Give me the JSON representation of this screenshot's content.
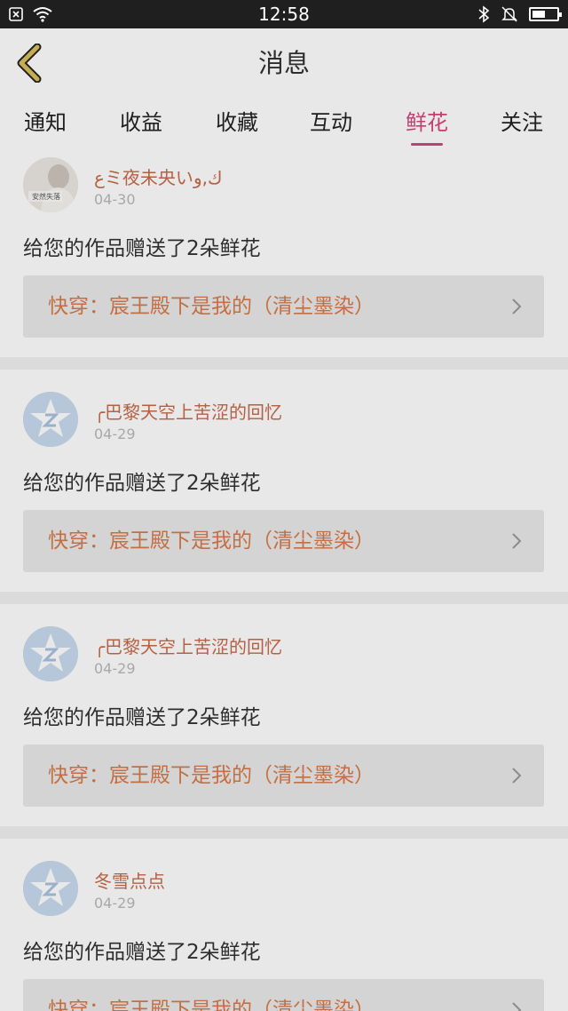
{
  "status_bar": {
    "time": "12:58",
    "left_icons": [
      "notification-x-icon",
      "wifi-icon"
    ],
    "right_icons": [
      "bluetooth-icon",
      "mute-bell-icon",
      "battery-icon"
    ]
  },
  "nav": {
    "title": "消息",
    "back_icon": "chevron-left-icon",
    "back_color": "#d8c05a"
  },
  "tabs": [
    {
      "label": "通知",
      "active": false
    },
    {
      "label": "收益",
      "active": false
    },
    {
      "label": "收藏",
      "active": false
    },
    {
      "label": "互动",
      "active": false
    },
    {
      "label": "鲜花",
      "active": true
    },
    {
      "label": "关注",
      "active": false
    }
  ],
  "accent_color": "#d6467c",
  "messages": [
    {
      "user": "ﻉミ夜未央いﻙ,ﻭ",
      "date": "04-30",
      "avatar": "photo-avatar",
      "avatar_caption": "安然失落",
      "text": "给您的作品赠送了2朵鲜花",
      "book": "快穿：宸王殿下是我的（清尘墨染）"
    },
    {
      "user": "╭巴黎天空上苦涩的回忆",
      "date": "04-29",
      "avatar": "default-avatar",
      "text": "给您的作品赠送了2朵鲜花",
      "book": "快穿：宸王殿下是我的（清尘墨染）"
    },
    {
      "user": "╭巴黎天空上苦涩的回忆",
      "date": "04-29",
      "avatar": "default-avatar",
      "text": "给您的作品赠送了2朵鲜花",
      "book": "快穿：宸王殿下是我的（清尘墨染）"
    },
    {
      "user": "冬雪点点",
      "date": "04-29",
      "avatar": "default-avatar",
      "text": "给您的作品赠送了2朵鲜花",
      "book": "快穿：宸王殿下是我的（清尘墨染）"
    }
  ]
}
